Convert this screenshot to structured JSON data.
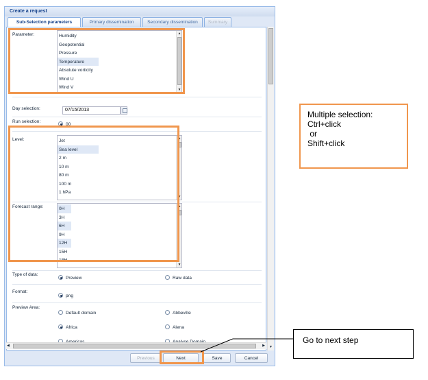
{
  "window": {
    "title": "Create a request",
    "tabs": [
      {
        "label": "Sub-Selection parameters",
        "state": "active"
      },
      {
        "label": "Primary dissemination",
        "state": "normal"
      },
      {
        "label": "Secondary dissemination",
        "state": "normal"
      },
      {
        "label": "Summary",
        "state": "disabled"
      }
    ]
  },
  "form": {
    "parameter": {
      "label": "Parameter:",
      "options": [
        "Humidity",
        "Geopotential",
        "Pressure",
        "Temperature",
        "Absolute vorticity",
        "Wind U",
        "Wind V"
      ],
      "selected": [
        "Temperature"
      ]
    },
    "day_selection": {
      "label": "Day selection:",
      "value": "07/15/2013"
    },
    "run_selection": {
      "label": "Run selection:",
      "option": "00"
    },
    "level": {
      "label": "Level:",
      "options": [
        "Jet",
        "Sea level",
        "2 m",
        "10 m",
        "80 m",
        "100 m",
        "1 hPa"
      ],
      "selected": [
        "Sea level"
      ]
    },
    "forecast_range": {
      "label": "Forecast range:",
      "options": [
        "0H",
        "3H",
        "6H",
        "9H",
        "12H",
        "15H",
        "18H"
      ],
      "selected": [
        "0H",
        "6H",
        "12H"
      ]
    },
    "type_of_data": {
      "label": "Type of data:",
      "options": [
        "Preview",
        "Raw data"
      ],
      "checked": "Preview"
    },
    "format": {
      "label": "Format:",
      "option": "png"
    },
    "preview_area": {
      "label": "Preview Area:",
      "options": [
        "Default domain",
        "Abbeville",
        "Africa",
        "Alena",
        "Americas",
        "Analyse Domain"
      ],
      "checked": "Africa"
    }
  },
  "buttons": {
    "previous": "Previous",
    "next": "Next",
    "save": "Save",
    "cancel": "Cancel"
  },
  "callouts": {
    "multiple_selection": [
      "Multiple selection:",
      "Ctrl+click",
      " or",
      "Shift+click"
    ],
    "next_step": "Go to next step"
  },
  "colors": {
    "highlight": "#f0964d",
    "selection": "#dfe8f6",
    "window_border": "#99bbe8"
  }
}
